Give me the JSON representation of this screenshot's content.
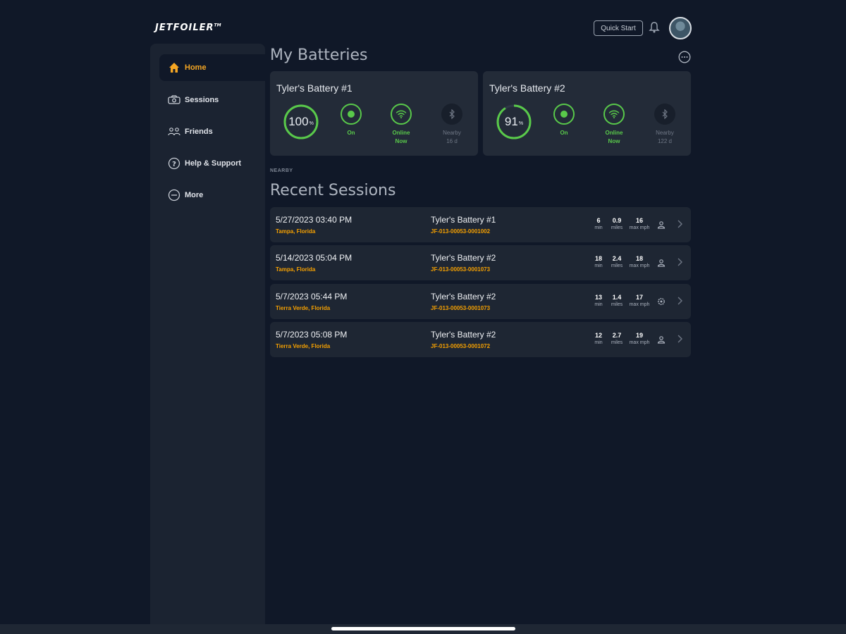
{
  "app": {
    "logo": "JETFOILER",
    "logo_tm": "TM"
  },
  "header": {
    "quick_start": "Quick Start"
  },
  "sidebar": {
    "items": [
      {
        "label": "Home",
        "icon": "home-icon",
        "active": true
      },
      {
        "label": "Sessions",
        "icon": "sessions-icon",
        "active": false
      },
      {
        "label": "Friends",
        "icon": "friends-icon",
        "active": false
      },
      {
        "label": "Help & Support",
        "icon": "help-icon",
        "active": false
      },
      {
        "label": "More",
        "icon": "more-icon",
        "active": false
      }
    ]
  },
  "batteries": {
    "title": "My Batteries",
    "nearby_label": "NEARBY",
    "cards": [
      {
        "name": "Tyler's Battery #1",
        "charge": "100",
        "charge_unit": "%",
        "charge_fraction": 1.0,
        "power": "On",
        "connectivity": [
          "Online",
          "Now"
        ],
        "nearby": [
          "Nearby",
          "16 d"
        ]
      },
      {
        "name": "Tyler's Battery #2",
        "charge": "91",
        "charge_unit": "%",
        "charge_fraction": 0.91,
        "power": "On",
        "connectivity": [
          "Online",
          "Now"
        ],
        "nearby": [
          "Nearby",
          "122 d"
        ]
      }
    ]
  },
  "sessions": {
    "title": "Recent Sessions",
    "units": {
      "time": "min",
      "distance": "miles",
      "speed": "max mph"
    },
    "rows": [
      {
        "date": "5/27/2023 03:40 PM",
        "location": "Tampa, Florida",
        "battery": "Tyler's Battery #1",
        "serial": "JF-013-00053-0001002",
        "time": "6",
        "distance": "0.9",
        "speed": "16",
        "icon": "person-icon"
      },
      {
        "date": "5/14/2023 05:04 PM",
        "location": "Tampa, Florida",
        "battery": "Tyler's Battery #2",
        "serial": "JF-013-00053-0001073",
        "time": "18",
        "distance": "2.4",
        "speed": "18",
        "icon": "person-icon"
      },
      {
        "date": "5/7/2023 05:44 PM",
        "location": "Tierra Verde, Florida",
        "battery": "Tyler's Battery #2",
        "serial": "JF-013-00053-0001073",
        "time": "13",
        "distance": "1.4",
        "speed": "17",
        "icon": "gear-icon"
      },
      {
        "date": "5/7/2023 05:08 PM",
        "location": "Tierra Verde, Florida",
        "battery": "Tyler's Battery #2",
        "serial": "JF-013-00053-0001072",
        "time": "12",
        "distance": "2.7",
        "speed": "19",
        "icon": "person-icon"
      }
    ]
  },
  "colors": {
    "accent": "#f5a623",
    "green": "#59c94a",
    "bg": "#101828",
    "card": "#232b38"
  }
}
